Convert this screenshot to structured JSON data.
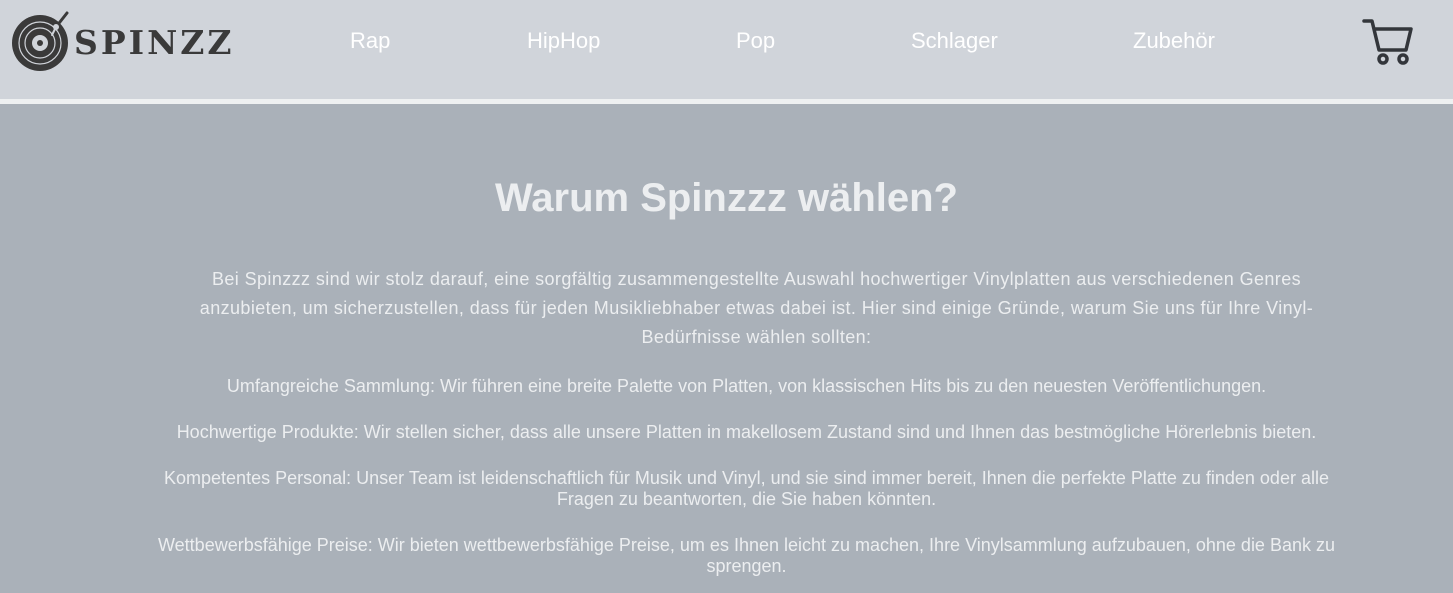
{
  "brand": {
    "logo_text": "SPINZZ"
  },
  "nav": {
    "items": [
      {
        "label": "Rap"
      },
      {
        "label": "HipHop"
      },
      {
        "label": "Pop"
      },
      {
        "label": "Schlager"
      },
      {
        "label": "Zubehör"
      }
    ],
    "cart_icon": "shopping-cart-icon"
  },
  "main": {
    "title": "Warum Spinzzz wählen?",
    "intro": "Bei Spinzzz sind wir stolz darauf, eine sorgfältig zusammengestellte Auswahl hochwertiger Vinylplatten aus verschiedenen Genres anzubieten, um sicherzustellen, dass für jeden Musikliebhaber etwas dabei ist. Hier sind einige Gründe, warum Sie uns für Ihre Vinyl-Bedürfnisse wählen sollten:",
    "points": [
      "Umfangreiche Sammlung: Wir führen eine breite Palette von Platten, von klassischen Hits bis zu den neuesten Veröffentlichungen.",
      "Hochwertige Produkte: Wir stellen sicher, dass alle unsere Platten in makellosem Zustand sind und Ihnen das bestmögliche Hörerlebnis bieten.",
      "Kompetentes Personal: Unser Team ist leidenschaftlich für Musik und Vinyl, und sie sind immer bereit, Ihnen die perfekte Platte zu finden oder alle Fragen zu beantworten, die Sie haben könnten.",
      "Wettbewerbsfähige Preise: Wir bieten wettbewerbsfähige Preise, um es Ihnen leicht zu machen, Ihre Vinylsammlung aufzubauen, ohne die Bank zu sprengen."
    ]
  },
  "colors": {
    "header_bg": "#d0d4da",
    "page_bg": "#aab1b9",
    "text": "#eceef0",
    "logo": "#3a3a3a"
  }
}
